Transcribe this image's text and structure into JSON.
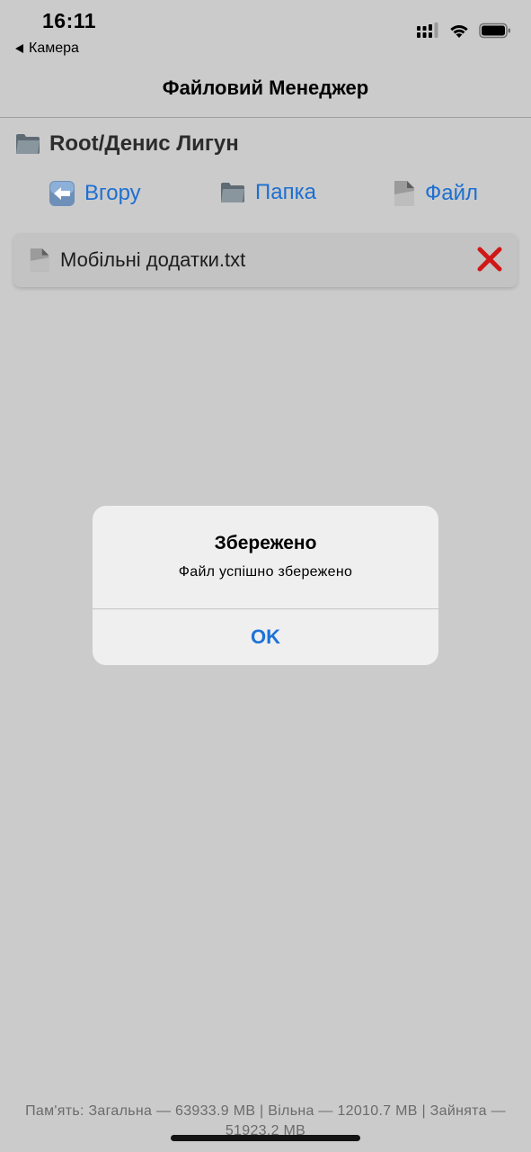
{
  "status_bar": {
    "time": "16:11",
    "back_app": "Камера",
    "icons": [
      "cellular-signal-icon",
      "wifi-icon",
      "battery-icon"
    ]
  },
  "nav": {
    "title": "Файловий Менеджер"
  },
  "path": {
    "text": "Root/Денис Лигун",
    "icon": "folder-icon"
  },
  "toolbar": {
    "up_label": "Вгору",
    "folder_label": "Папка",
    "file_label": "Файл"
  },
  "files": [
    {
      "name": "Мобільні додатки.txt",
      "icon": "document-icon"
    }
  ],
  "alert": {
    "title": "Збережено",
    "message": "Файл успішно збережено",
    "ok_label": "OK"
  },
  "footer": {
    "memory": "Пам'ять: Загальна — 63933.9 MB | Вільна — 12010.7 MB | Зайнята — 51923.2 MB"
  },
  "colors": {
    "background": "#cbcbcb",
    "accent": "#1d6fd1",
    "delete": "#d01818",
    "alert_background": "#efefef"
  }
}
